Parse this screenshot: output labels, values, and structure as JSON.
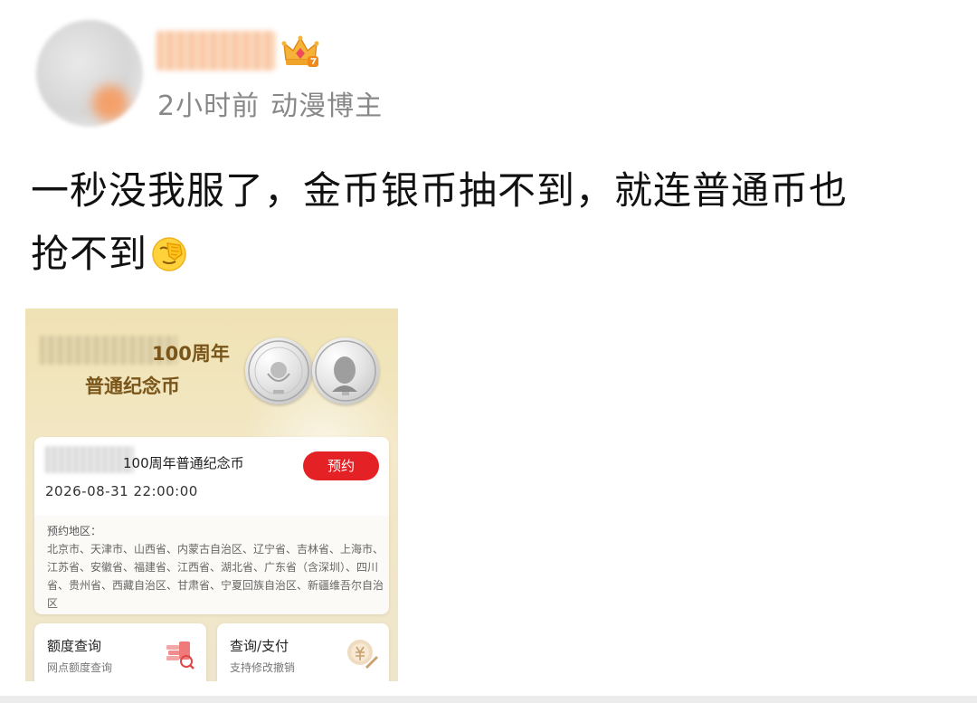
{
  "post": {
    "time": "2小时前",
    "tag": "动漫博主",
    "text_line1": "一秒没我服了，金币银币抽不到，就连普通币也",
    "text_line2": "抢不到"
  },
  "image": {
    "banner_line1": "100周年",
    "banner_line2": "普通纪念币",
    "item_name": "100周年普通纪念币",
    "reserve_label": "预约",
    "datetime": "2026-08-31 22:00:00",
    "regions_label": "预约地区：",
    "regions": "北京市、天津市、山西省、内蒙古自治区、辽宁省、吉林省、上海市、江苏省、安徽省、福建省、江西省、湖北省、广东省（含深圳）、四川省、贵州省、西藏自治区、甘肃省、宁夏回族自治区、新疆维吾尔自治区",
    "cards": [
      {
        "title": "额度查询",
        "subtitle": "网点额度查询",
        "icon": "coins-search-icon"
      },
      {
        "title": "查询/支付",
        "subtitle": "支持修改撤销",
        "icon": "payment-icon"
      }
    ]
  },
  "colors": {
    "reserve_button": "#e42225",
    "banner_text": "#7a5519",
    "meta_text": "#888888",
    "image_bg": "#efe2b4"
  }
}
